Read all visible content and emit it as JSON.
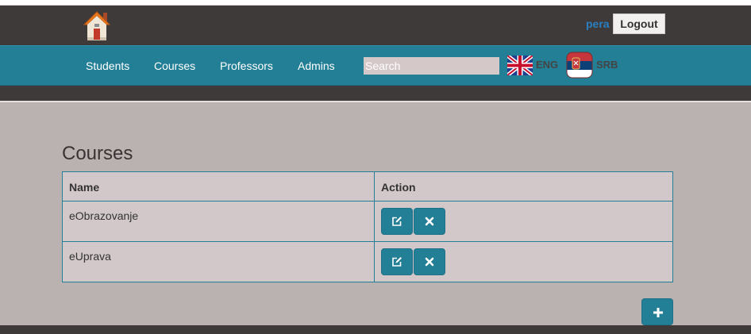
{
  "header": {
    "username": "pera",
    "logout_label": "Logout"
  },
  "nav": {
    "items": [
      {
        "label": "Students"
      },
      {
        "label": "Courses"
      },
      {
        "label": "Professors"
      },
      {
        "label": "Admins"
      }
    ],
    "search_placeholder": "Search",
    "search_value": "",
    "languages": [
      {
        "label": "ENG",
        "icon": "uk-flag-icon"
      },
      {
        "label": "SRB",
        "icon": "serbia-flag-icon"
      }
    ]
  },
  "main": {
    "title": "Courses",
    "table": {
      "headers": [
        "Name",
        "Action"
      ],
      "rows": [
        {
          "name": "eObrazovanje"
        },
        {
          "name": "eUprava"
        }
      ]
    }
  },
  "colors": {
    "accent": "#237f96",
    "header_dark": "#3f3a3a",
    "username": "#2a7fc0",
    "background": "#bab1b1",
    "table_bg": "#d3c8c9"
  }
}
